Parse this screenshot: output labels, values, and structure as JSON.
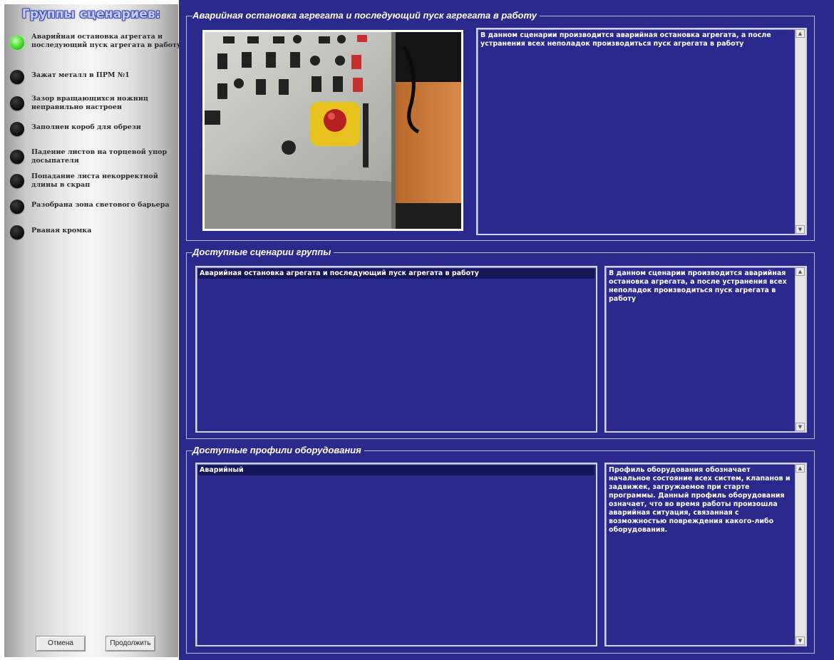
{
  "sidebar": {
    "title": "Группы сценариев:",
    "scenarios": [
      {
        "label": "Аварийная остановка агрегата и последующий пуск агрегата в работу",
        "active": true
      },
      {
        "label": "Зажат металл в ПРМ №1",
        "active": false
      },
      {
        "label": "Зазор вращающихся ножниц неправильно настроен",
        "active": false
      },
      {
        "label": "Заполнен короб для обрези",
        "active": false
      },
      {
        "label": "Падение листов на торцевой упор досыпателя",
        "active": false
      },
      {
        "label": "Попадание листа некорректной длины в скрап",
        "active": false
      },
      {
        "label": "Разобрана зона светового барьера",
        "active": false
      },
      {
        "label": "Рваная кромка",
        "active": false
      }
    ],
    "cancel_label": "Отмена",
    "continue_label": "Продолжить"
  },
  "groups": {
    "current": {
      "title": "Аварийная остановка агрегата и последующий пуск агрегата в работу",
      "description": "В данном сценарии производится аварийная остановка агрегата, а после устранения всех неполадок производиться пуск агрегата в работу"
    },
    "available_scenarios": {
      "title": "Доступные сценарии группы",
      "items": [
        "Аварийная остановка агрегата и последующий пуск агрегата в работу"
      ],
      "description": "В данном сценарии производится аварийная остановка агрегата, а после устранения всех неполадок производиться пуск агрегата в работу"
    },
    "profiles": {
      "title": "Доступные профили оборудования",
      "items": [
        "Аварийный"
      ],
      "description": "Профиль оборудования обозначает начальное состояние всех систем, клапанов и задвижек, загружаемое при старте программы. Данный профиль оборудования означает, что во время работы произошла аварийная ситуация, связанная с возможностью повреждения какого-либо оборудования."
    }
  },
  "colors": {
    "main_background": "#2b2a8c",
    "selection": "#151655",
    "active_indicator": "#55e23a",
    "sidebar_title": "#c2cdfb"
  }
}
